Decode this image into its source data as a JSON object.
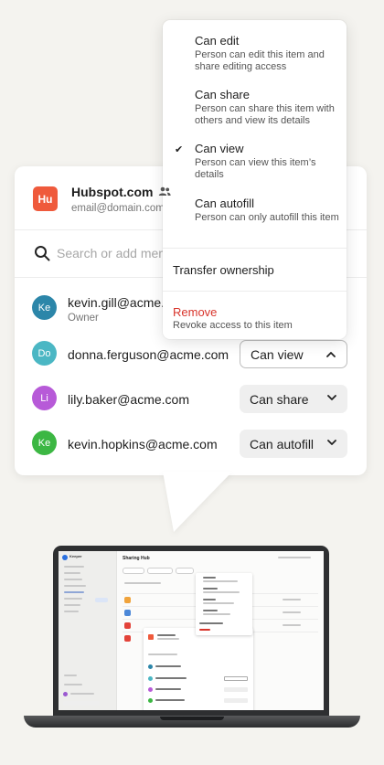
{
  "item": {
    "logo_text": "Hu",
    "name": "Hubspot.com",
    "email": "email@domain.com",
    "logo_color": "#ef5a3c",
    "shared_icon": "people-icon"
  },
  "search": {
    "placeholder": "Search or add members"
  },
  "members": [
    {
      "initials": "Ke",
      "email": "kevin.gill@acme.com",
      "role": "Owner",
      "avatar_color": "#2c86a9"
    },
    {
      "initials": "Do",
      "email": "donna.ferguson@acme.com",
      "permission": "Can view",
      "avatar_color": "#4bb7c4"
    },
    {
      "initials": "Li",
      "email": "lily.baker@acme.com",
      "permission": "Can share",
      "avatar_color": "#b75ad8"
    },
    {
      "initials": "Ke",
      "email": "kevin.hopkins@acme.com",
      "permission": "Can autofill",
      "avatar_color": "#3cb743"
    }
  ],
  "menu": {
    "options": [
      {
        "title": "Can edit",
        "desc": "Person can edit this item and share editing access",
        "checked": false
      },
      {
        "title": "Can share",
        "desc": "Person can share this item with others and view its details",
        "checked": false
      },
      {
        "title": "Can view",
        "desc": "Person can view this item’s details",
        "checked": true
      },
      {
        "title": "Can autofill",
        "desc": "Person can only autofill this item",
        "checked": false
      }
    ],
    "check_mark": "✔",
    "transfer": "Transfer ownership",
    "remove_title": "Remove",
    "remove_desc": "Revoke access to this item",
    "remove_color": "#d8342b"
  },
  "laptop": {
    "app_brand": "Keeper",
    "page_heading": "Sharing Hub"
  }
}
